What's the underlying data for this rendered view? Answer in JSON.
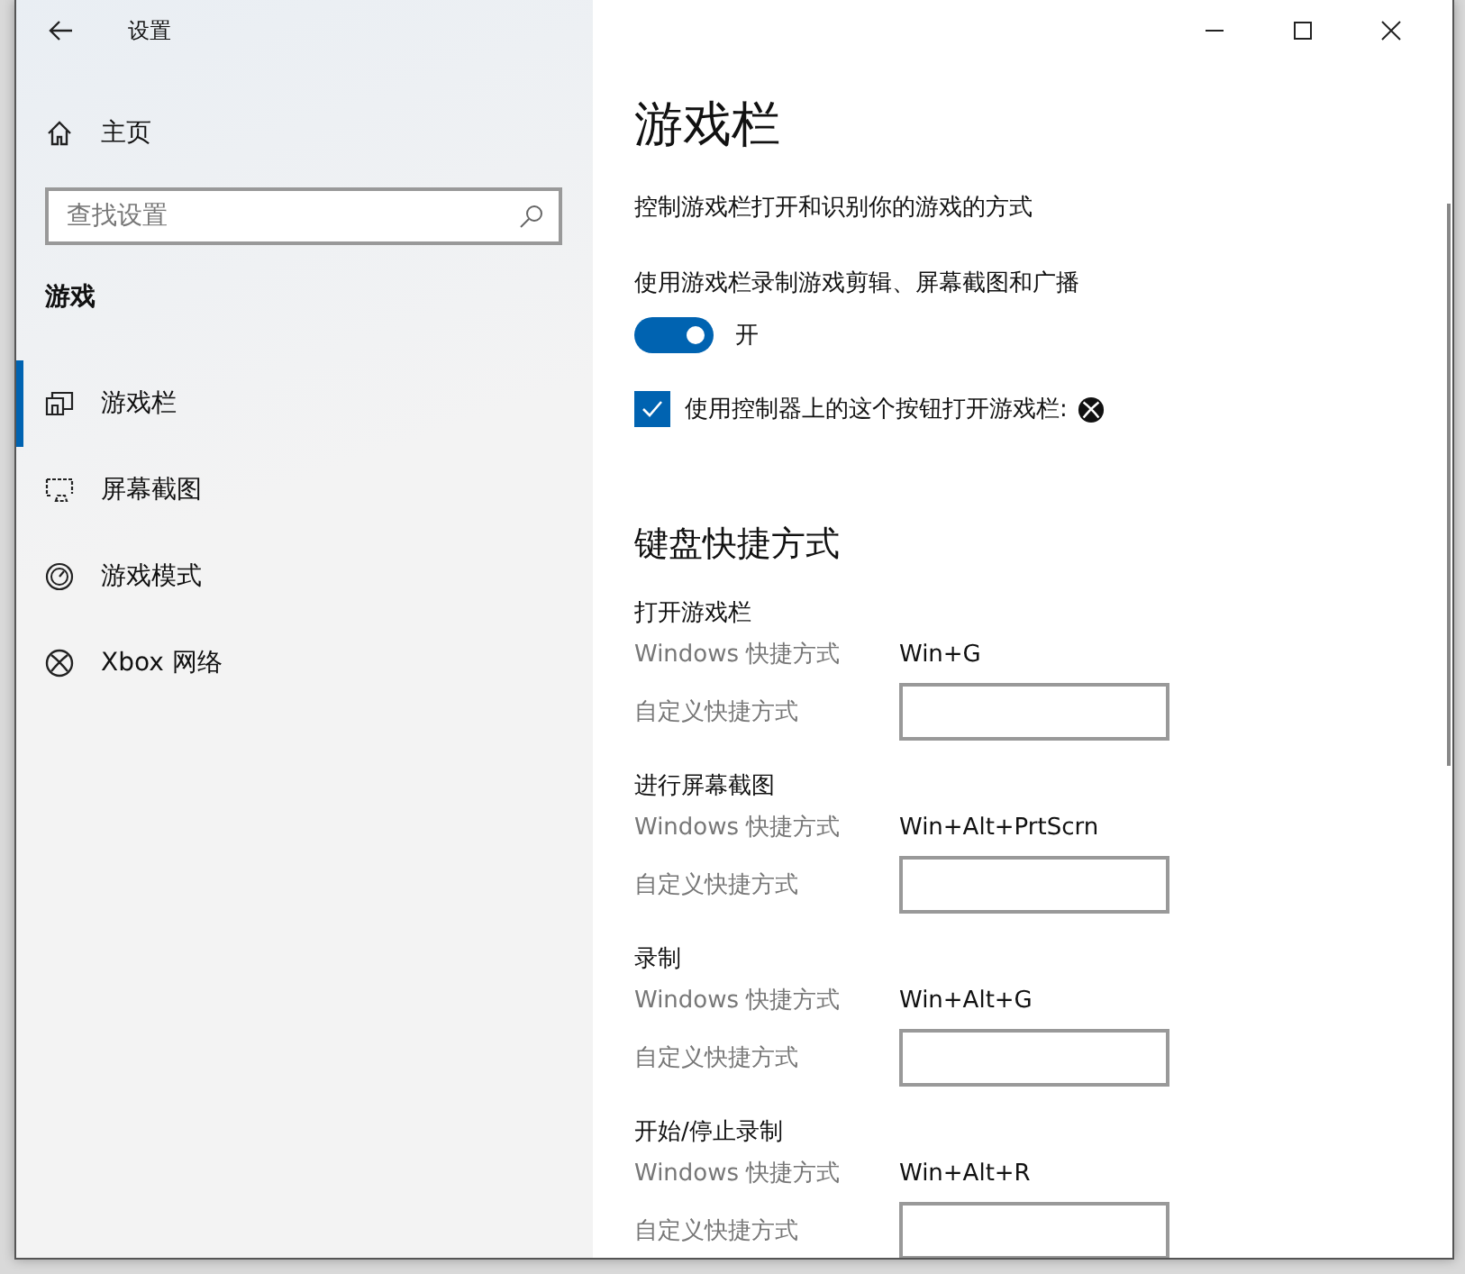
{
  "window": {
    "title": "设置"
  },
  "sidebar": {
    "home": "主页",
    "search": {
      "placeholder": "查找设置"
    },
    "section": "游戏",
    "items": [
      {
        "label": "游戏栏",
        "kind": "gamebar",
        "selected": true
      },
      {
        "label": "屏幕截图",
        "kind": "capture",
        "selected": false
      },
      {
        "label": "游戏模式",
        "kind": "gamemode",
        "selected": false
      },
      {
        "label": "Xbox 网络",
        "kind": "xbox",
        "selected": false
      }
    ]
  },
  "page": {
    "title": "游戏栏",
    "description": "控制游戏栏打开和识别你的游戏的方式",
    "toggle": {
      "label": "使用游戏栏录制游戏剪辑、屏幕截图和广播",
      "on": true,
      "state_text": "开"
    },
    "checkbox": {
      "label": "使用控制器上的这个按钮打开游戏栏:",
      "checked": true
    },
    "shortcuts_title": "键盘快捷方式",
    "shortcuts": [
      {
        "name": "打开游戏栏",
        "windows_label": "Windows 快捷方式",
        "windows_value": "Win+G",
        "custom_label": "自定义快捷方式"
      },
      {
        "name": "进行屏幕截图",
        "windows_label": "Windows 快捷方式",
        "windows_value": "Win+Alt+PrtScrn",
        "custom_label": "自定义快捷方式"
      },
      {
        "name": "录制",
        "windows_label": "Windows 快捷方式",
        "windows_value": "Win+Alt+G",
        "custom_label": "自定义快捷方式"
      },
      {
        "name": "开始/停止录制",
        "windows_label": "Windows 快捷方式",
        "windows_value": "Win+Alt+R",
        "custom_label": "自定义快捷方式"
      }
    ]
  }
}
